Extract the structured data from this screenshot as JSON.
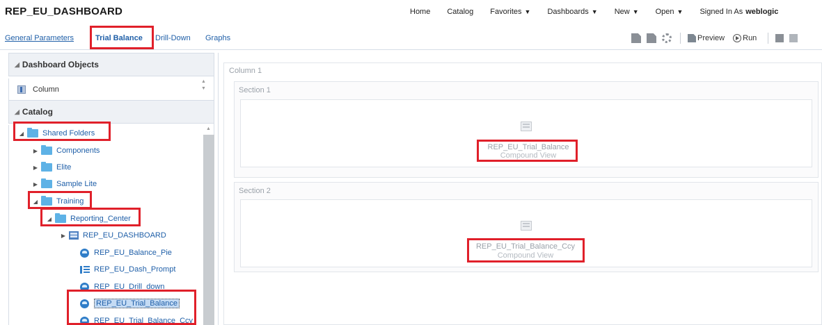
{
  "app": {
    "title": "REP_EU_DASHBOARD"
  },
  "global_nav": {
    "home": "Home",
    "catalog": "Catalog",
    "favorites": "Favorites",
    "dashboards": "Dashboards",
    "new": "New",
    "open": "Open",
    "signed_in_label": "Signed In As",
    "signed_in_user": "weblogic"
  },
  "tabs": {
    "general": "General Parameters",
    "trial_balance": "Trial Balance",
    "drill_down": "Drill-Down",
    "graphs": "Graphs"
  },
  "toolbar": {
    "preview": "Preview",
    "run": "Run"
  },
  "left_panel": {
    "dashboard_objects_header": "Dashboard Objects",
    "objects": [
      {
        "label": "Column",
        "icon": "column-icon"
      }
    ],
    "catalog_header": "Catalog",
    "tree": {
      "shared_folders": "Shared Folders",
      "components": "Components",
      "elite": "Elite",
      "sample_lite": "Sample Lite",
      "training": "Training",
      "reporting_center": "Reporting_Center",
      "items": [
        {
          "label": "REP_EU_DASHBOARD",
          "icon": "dashboard-icon"
        },
        {
          "label": "REP_EU_Balance_Pie",
          "icon": "analysis-icon"
        },
        {
          "label": "REP_EU_Dash_Prompt",
          "icon": "prompt-icon"
        },
        {
          "label": "REP_EU_Drill_down",
          "icon": "analysis-icon"
        },
        {
          "label": "REP_EU_Trial_Balance",
          "icon": "analysis-icon"
        },
        {
          "label": "REP_EU_Trial_Balance_Ccy",
          "icon": "analysis-icon"
        }
      ]
    }
  },
  "canvas": {
    "column_label": "Column 1",
    "sections": [
      {
        "label": "Section 1",
        "view_title": "REP_EU_Trial_Balance",
        "view_subtitle": "Compound View"
      },
      {
        "label": "Section 2",
        "view_title": "REP_EU_Trial_Balance_Ccy",
        "view_subtitle": "Compound View"
      }
    ]
  },
  "colors": {
    "highlight": "#e0202a",
    "link": "#1f5fa8",
    "folder": "#5eb2e6"
  }
}
